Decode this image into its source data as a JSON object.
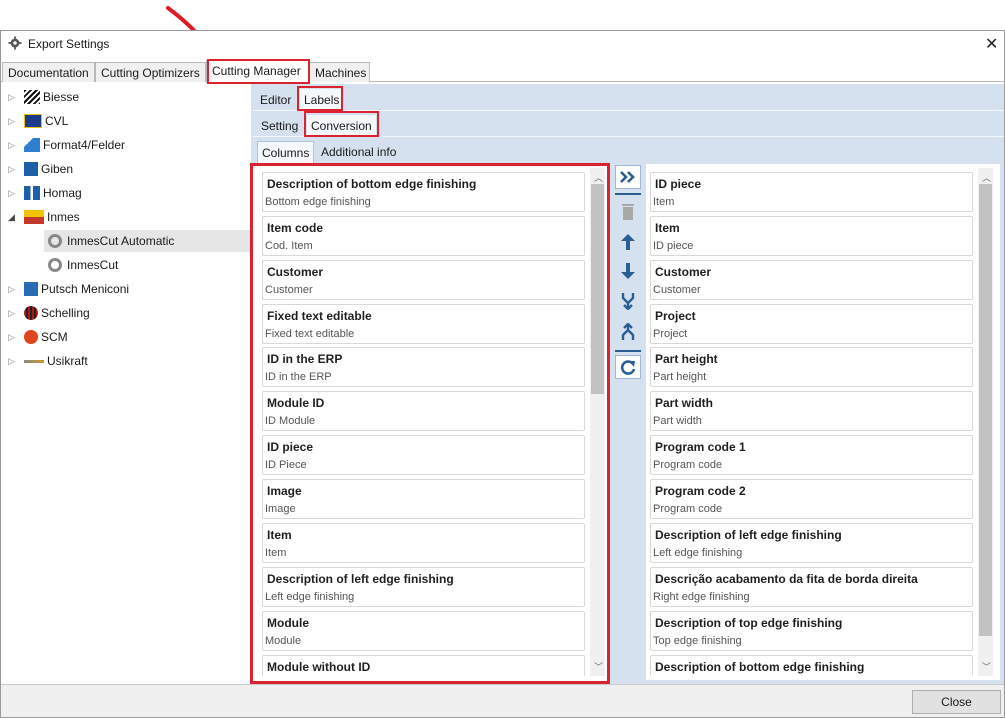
{
  "window": {
    "title": "Export Settings"
  },
  "tabs": [
    {
      "label": "Documentation"
    },
    {
      "label": "Cutting Optimizers"
    },
    {
      "label": "Cutting Manager"
    },
    {
      "label": "Machines"
    }
  ],
  "tree": [
    {
      "label": "Biesse",
      "expanded": false
    },
    {
      "label": "CVL",
      "expanded": false
    },
    {
      "label": "Format4/Felder",
      "expanded": false
    },
    {
      "label": "Giben",
      "expanded": false
    },
    {
      "label": "Homag",
      "expanded": false
    },
    {
      "label": "Inmes",
      "expanded": true
    },
    {
      "label": "InmesCut Automatic",
      "child": true,
      "selected": true
    },
    {
      "label": "InmesCut",
      "child": true
    },
    {
      "label": "Putsch Meniconi",
      "expanded": false
    },
    {
      "label": "Schelling",
      "expanded": false
    },
    {
      "label": "SCM",
      "expanded": false
    },
    {
      "label": "Usikraft",
      "expanded": false
    }
  ],
  "subtabs1": {
    "editor": "Editor",
    "labels": "Labels"
  },
  "subtabs2": {
    "setting": "Setting",
    "conversion": "Conversion"
  },
  "subtabs3": {
    "columns": "Columns",
    "additional": "Additional info"
  },
  "available": [
    {
      "title": "Description of bottom edge finishing",
      "sub": "Bottom edge finishing"
    },
    {
      "title": "Item code",
      "sub": "Cod. Item"
    },
    {
      "title": "Customer",
      "sub": "Customer"
    },
    {
      "title": "Fixed text editable",
      "sub": "Fixed text editable"
    },
    {
      "title": "ID in the ERP",
      "sub": "ID in the ERP"
    },
    {
      "title": "Module ID",
      "sub": "ID Module"
    },
    {
      "title": "ID piece",
      "sub": "ID Piece"
    },
    {
      "title": "Image",
      "sub": "Image"
    },
    {
      "title": "Item",
      "sub": "Item"
    },
    {
      "title": "Description of left edge finishing",
      "sub": "Left edge finishing"
    },
    {
      "title": "Module",
      "sub": "Module"
    },
    {
      "title": "Module without ID",
      "sub": ""
    }
  ],
  "selected": [
    {
      "title": "ID piece",
      "sub": "Item"
    },
    {
      "title": "Item",
      "sub": "ID piece"
    },
    {
      "title": "Customer",
      "sub": "Customer"
    },
    {
      "title": "Project",
      "sub": "Project"
    },
    {
      "title": "Part height",
      "sub": "Part height"
    },
    {
      "title": "Part width",
      "sub": "Part width"
    },
    {
      "title": "Program code 1",
      "sub": "Program code"
    },
    {
      "title": "Program code 2",
      "sub": "Program code"
    },
    {
      "title": "Description of left edge finishing",
      "sub": "Left edge finishing"
    },
    {
      "title": "Descrição acabamento da fita de borda direita",
      "sub": "Right edge finishing"
    },
    {
      "title": "Description of top edge finishing",
      "sub": "Top edge finishing"
    },
    {
      "title": "Description of bottom edge finishing",
      "sub": ""
    }
  ],
  "tools": [
    {
      "icon": "double-chevron-right-icon"
    },
    {
      "icon": "trash-icon"
    },
    {
      "icon": "arrow-up-icon"
    },
    {
      "icon": "arrow-down-icon"
    },
    {
      "icon": "merge-icon"
    },
    {
      "icon": "split-icon"
    },
    {
      "icon": "refresh-icon"
    }
  ],
  "footer": {
    "close_label": "Close"
  },
  "colors": {
    "highlight": "#d9232e",
    "pane": "#d5e1ef",
    "tool": "#2b5f93"
  }
}
